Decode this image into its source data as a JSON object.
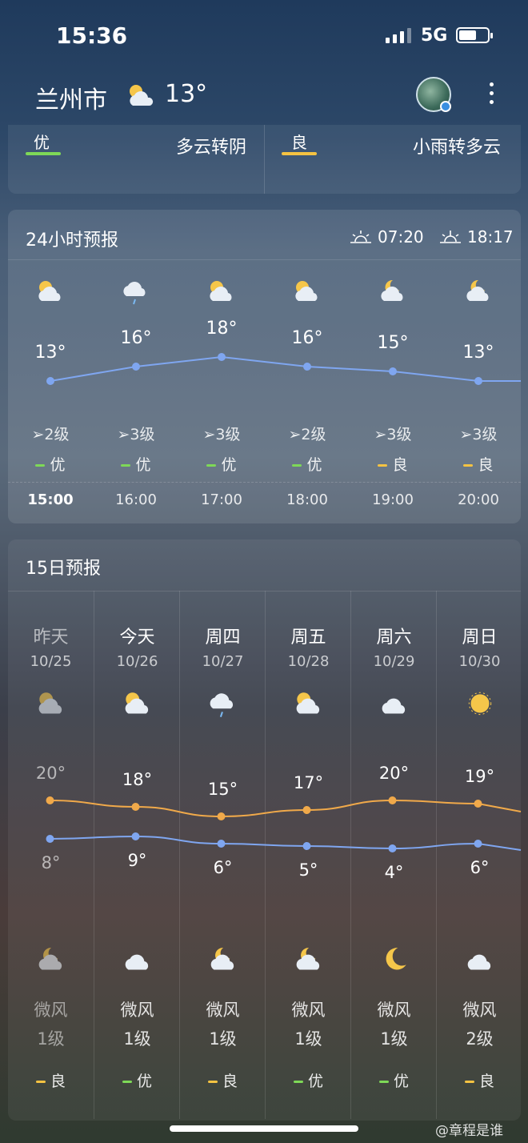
{
  "status": {
    "time": "15:36",
    "network": "5G",
    "battery_pct": 0.55
  },
  "header": {
    "city": "兰州市",
    "temp": "13°",
    "weather_icon": "partly-cloudy-icon"
  },
  "aq_today": {
    "level": "优",
    "color": "#7ed957",
    "condition": "多云转阴"
  },
  "aq_tomorrow": {
    "level": "良",
    "color": "#f5c342",
    "condition": "小雨转多云"
  },
  "hourly": {
    "title": "24小时预报",
    "sunrise": "07:20",
    "sunset": "18:17",
    "items": [
      {
        "time": "15:00",
        "temp": "13°",
        "t": 13,
        "icon": "partly-cloudy",
        "wind": "2级",
        "aq": "优",
        "aq_color": "#7ed957",
        "now": true
      },
      {
        "time": "16:00",
        "temp": "16°",
        "t": 16,
        "icon": "rain-cloud",
        "wind": "3级",
        "aq": "优",
        "aq_color": "#7ed957"
      },
      {
        "time": "17:00",
        "temp": "18°",
        "t": 18,
        "icon": "partly-cloudy",
        "wind": "3级",
        "aq": "优",
        "aq_color": "#7ed957"
      },
      {
        "time": "18:00",
        "temp": "16°",
        "t": 16,
        "icon": "partly-cloudy",
        "wind": "2级",
        "aq": "优",
        "aq_color": "#7ed957"
      },
      {
        "time": "19:00",
        "temp": "15°",
        "t": 15,
        "icon": "night-cloudy",
        "wind": "3级",
        "aq": "良",
        "aq_color": "#f5c342"
      },
      {
        "time": "20:00",
        "temp": "13°",
        "t": 13,
        "icon": "night-cloudy",
        "wind": "3级",
        "aq": "良",
        "aq_color": "#f5c342"
      }
    ]
  },
  "daily": {
    "title": "15日预报",
    "items": [
      {
        "day": "昨天",
        "date": "10/25",
        "high": "20°",
        "h": 20,
        "low": "8°",
        "l": 8,
        "icon_day": "partly-cloudy",
        "icon_night": "night-cloudy",
        "wind": "微风",
        "level": "1级",
        "aq": "良",
        "aq_color": "#f5c342",
        "past": true
      },
      {
        "day": "今天",
        "date": "10/26",
        "high": "18°",
        "h": 18,
        "low": "9°",
        "l": 9,
        "icon_day": "partly-cloudy",
        "icon_night": "cloudy",
        "wind": "微风",
        "level": "1级",
        "aq": "优",
        "aq_color": "#7ed957"
      },
      {
        "day": "周四",
        "date": "10/27",
        "high": "15°",
        "h": 15,
        "low": "6°",
        "l": 6,
        "icon_day": "rain-cloud",
        "icon_night": "night-cloudy",
        "wind": "微风",
        "level": "1级",
        "aq": "良",
        "aq_color": "#f5c342"
      },
      {
        "day": "周五",
        "date": "10/28",
        "high": "17°",
        "h": 17,
        "low": "5°",
        "l": 5,
        "icon_day": "partly-cloudy",
        "icon_night": "night-cloudy",
        "wind": "微风",
        "level": "1级",
        "aq": "优",
        "aq_color": "#7ed957"
      },
      {
        "day": "周六",
        "date": "10/29",
        "high": "20°",
        "h": 20,
        "low": "4°",
        "l": 4,
        "icon_day": "cloudy",
        "icon_night": "moon",
        "wind": "微风",
        "level": "1级",
        "aq": "优",
        "aq_color": "#7ed957"
      },
      {
        "day": "周日",
        "date": "10/30",
        "high": "19°",
        "h": 19,
        "low": "6°",
        "l": 6,
        "icon_day": "sunny",
        "icon_night": "cloudy",
        "wind": "微风",
        "level": "2级",
        "aq": "良",
        "aq_color": "#f5c342"
      }
    ]
  },
  "watermark": "@章程是谁"
}
